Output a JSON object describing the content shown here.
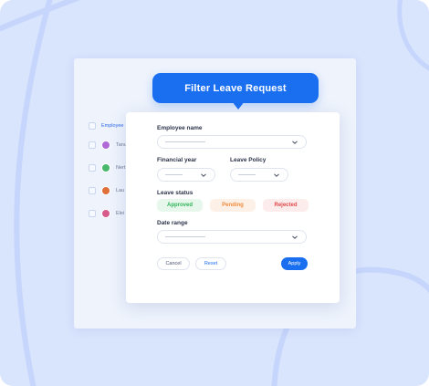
{
  "colors": {
    "accent": "#1a6ff1",
    "approved_bg": "#e7f7ec",
    "approved_text": "#2fb457",
    "pending_bg": "#fdf1e7",
    "pending_text": "#f08a3c",
    "rejected_bg": "#fdecec",
    "rejected_text": "#e04848"
  },
  "tooltip": {
    "title": "Filter Leave Request"
  },
  "background_table": {
    "header": "Employee",
    "rows": [
      {
        "name": "Tanu",
        "avatar_color": "#b06ad8"
      },
      {
        "name": "Nert",
        "avatar_color": "#48b86a"
      },
      {
        "name": "Lau",
        "avatar_color": "#e0703a"
      },
      {
        "name": "Elei",
        "avatar_color": "#d65a8a"
      }
    ]
  },
  "filter": {
    "employee_name_label": "Employee name",
    "financial_year_label": "Financial year",
    "leave_policy_label": "Leave Policy",
    "leave_status_label": "Leave status",
    "status_options": [
      "Approved",
      "Pending",
      "Rejected"
    ],
    "date_range_label": "Date range",
    "buttons": {
      "cancel": "Cancel",
      "reset": "Reset",
      "apply": "Apply"
    }
  }
}
